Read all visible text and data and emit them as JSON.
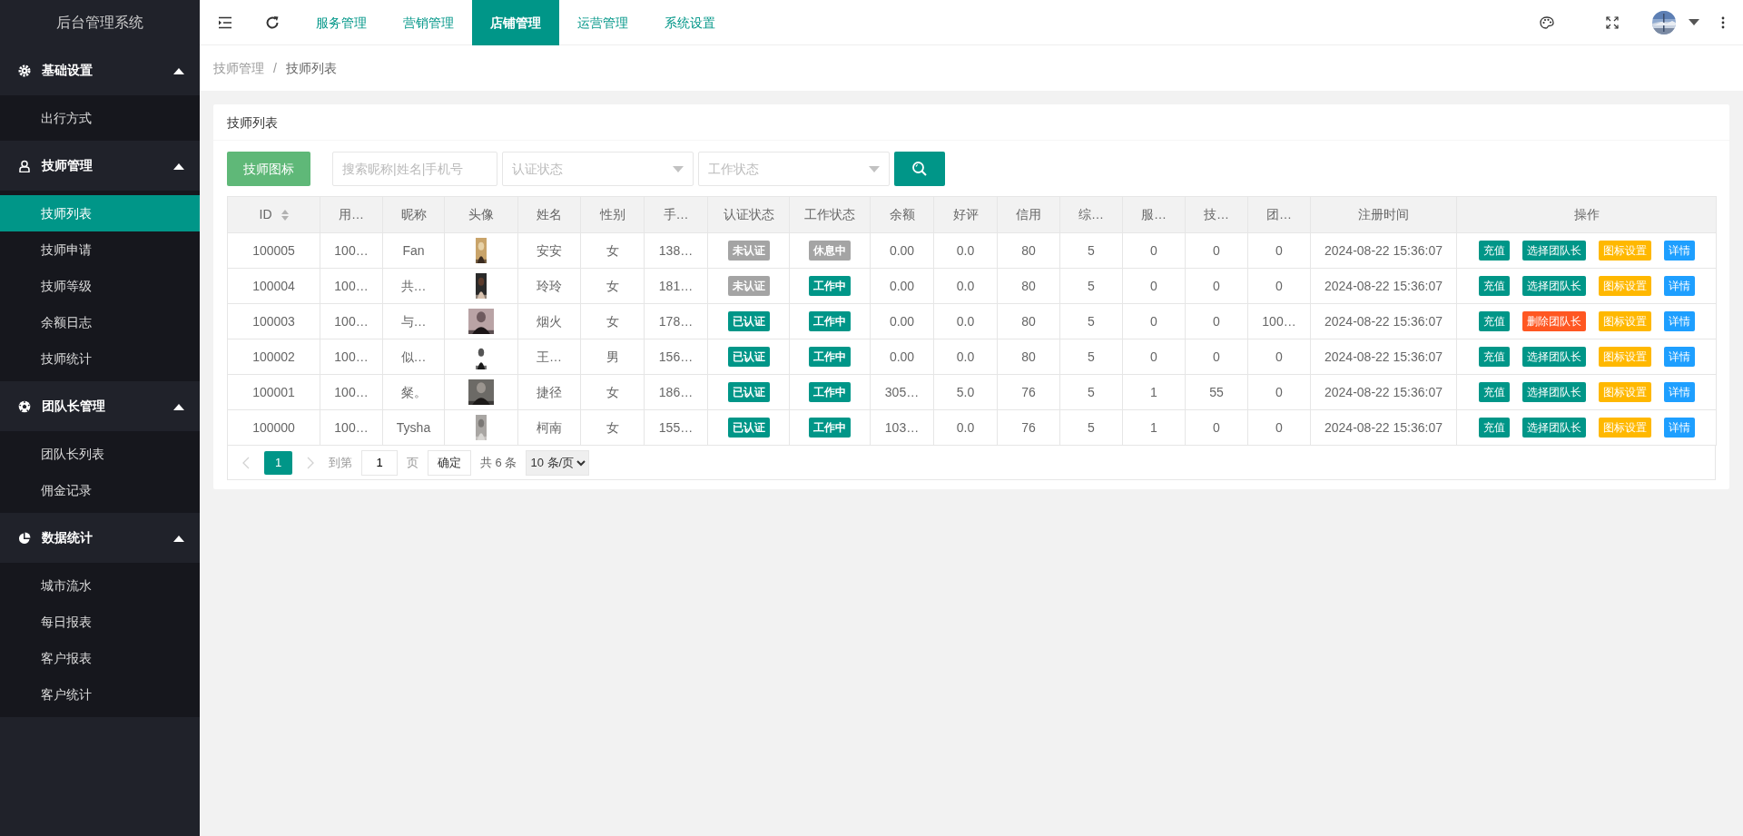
{
  "app_title": "后台管理系统",
  "sidebar": {
    "groups": [
      {
        "label": "基础设置",
        "expanded": true,
        "items": [
          {
            "label": "出行方式",
            "selected": false
          }
        ]
      },
      {
        "label": "技师管理",
        "expanded": true,
        "items": [
          {
            "label": "技师列表",
            "selected": true
          },
          {
            "label": "技师申请",
            "selected": false
          },
          {
            "label": "技师等级",
            "selected": false
          },
          {
            "label": "余额日志",
            "selected": false
          },
          {
            "label": "技师统计",
            "selected": false
          }
        ]
      },
      {
        "label": "团队长管理",
        "expanded": true,
        "items": [
          {
            "label": "团队长列表",
            "selected": false
          },
          {
            "label": "佣金记录",
            "selected": false
          }
        ]
      },
      {
        "label": "数据统计",
        "expanded": true,
        "items": [
          {
            "label": "城市流水",
            "selected": false
          },
          {
            "label": "每日报表",
            "selected": false
          },
          {
            "label": "客户报表",
            "selected": false
          },
          {
            "label": "客户统计",
            "selected": false
          }
        ]
      }
    ]
  },
  "topbar": {
    "tabs": [
      {
        "label": "服务管理",
        "selected": false
      },
      {
        "label": "营销管理",
        "selected": false
      },
      {
        "label": "店铺管理",
        "selected": true
      },
      {
        "label": "运营管理",
        "selected": false
      },
      {
        "label": "系统设置",
        "selected": false
      }
    ],
    "user_avatar": {
      "kind": "picture"
    }
  },
  "breadcrumb": [
    "技师管理",
    "技师列表"
  ],
  "breadcrumb_separator": "/",
  "card": {
    "title": "技师列表"
  },
  "toolbar": {
    "icon_button": "技师图标",
    "search": {
      "placeholder": "搜索昵称|姓名|手机号"
    },
    "filters": [
      {
        "placeholder": "认证状态"
      },
      {
        "placeholder": "工作状态"
      }
    ]
  },
  "table": {
    "columns": [
      {
        "label": "ID",
        "sortable": true
      },
      {
        "label": "用…",
        "sortable": false
      },
      {
        "label": "昵称",
        "sortable": false
      },
      {
        "label": "头像",
        "sortable": false
      },
      {
        "label": "姓名",
        "sortable": false
      },
      {
        "label": "性别",
        "sortable": false
      },
      {
        "label": "手…",
        "sortable": false
      },
      {
        "label": "认证状态",
        "sortable": false
      },
      {
        "label": "工作状态",
        "sortable": false
      },
      {
        "label": "余额",
        "sortable": false
      },
      {
        "label": "好评",
        "sortable": false
      },
      {
        "label": "信用",
        "sortable": false
      },
      {
        "label": "综…",
        "sortable": false
      },
      {
        "label": "服…",
        "sortable": false
      },
      {
        "label": "技…",
        "sortable": false
      },
      {
        "label": "团…",
        "sortable": false
      },
      {
        "label": "注册时间",
        "sortable": false
      },
      {
        "label": "操作",
        "sortable": false
      }
    ],
    "rows": [
      {
        "id": "100005",
        "user": "100…",
        "nickname": "Fan",
        "avatar": {
          "kind": "picture"
        },
        "name": "安安",
        "gender": "女",
        "phone": "138…",
        "auth": {
          "label": "未认证",
          "verified": false
        },
        "work": {
          "label": "休息中",
          "working": false
        },
        "balance": "0.00",
        "rating": "0.0",
        "credit": "80",
        "column_13": "5",
        "column_14": "0",
        "column_15": "0",
        "column_16": "0",
        "registered": "2024-08-22 15:36:07",
        "actions": [
          {
            "label": "充值",
            "kind": "recharge"
          },
          {
            "label": "选择团队长",
            "kind": "select"
          },
          {
            "label": "图标设置",
            "kind": "icon"
          },
          {
            "label": "详情",
            "kind": "detail"
          }
        ]
      },
      {
        "id": "100004",
        "user": "100…",
        "nickname": "共…",
        "avatar": {
          "kind": "picture"
        },
        "name": "玲玲",
        "gender": "女",
        "phone": "181…",
        "auth": {
          "label": "未认证",
          "verified": false
        },
        "work": {
          "label": "工作中",
          "working": true
        },
        "balance": "0.00",
        "rating": "0.0",
        "credit": "80",
        "column_13": "5",
        "column_14": "0",
        "column_15": "0",
        "column_16": "0",
        "registered": "2024-08-22 15:36:07",
        "actions": [
          {
            "label": "充值",
            "kind": "recharge"
          },
          {
            "label": "选择团队长",
            "kind": "select"
          },
          {
            "label": "图标设置",
            "kind": "icon"
          },
          {
            "label": "详情",
            "kind": "detail"
          }
        ]
      },
      {
        "id": "100003",
        "user": "100…",
        "nickname": "与…",
        "avatar": {
          "kind": "picture"
        },
        "name": "烟火",
        "gender": "女",
        "phone": "178…",
        "auth": {
          "label": "已认证",
          "verified": true
        },
        "work": {
          "label": "工作中",
          "working": true
        },
        "balance": "0.00",
        "rating": "0.0",
        "credit": "80",
        "column_13": "5",
        "column_14": "0",
        "column_15": "0",
        "column_16": "100…",
        "registered": "2024-08-22 15:36:07",
        "actions": [
          {
            "label": "充值",
            "kind": "recharge"
          },
          {
            "label": "删除团队长",
            "kind": "remove"
          },
          {
            "label": "图标设置",
            "kind": "icon"
          },
          {
            "label": "详情",
            "kind": "detail"
          }
        ]
      },
      {
        "id": "100002",
        "user": "100…",
        "nickname": "似…",
        "avatar": {
          "kind": "picture"
        },
        "name": "王…",
        "gender": "男",
        "phone": "156…",
        "auth": {
          "label": "已认证",
          "verified": true
        },
        "work": {
          "label": "工作中",
          "working": true
        },
        "balance": "0.00",
        "rating": "0.0",
        "credit": "80",
        "column_13": "5",
        "column_14": "0",
        "column_15": "0",
        "column_16": "0",
        "registered": "2024-08-22 15:36:07",
        "actions": [
          {
            "label": "充值",
            "kind": "recharge"
          },
          {
            "label": "选择团队长",
            "kind": "select"
          },
          {
            "label": "图标设置",
            "kind": "icon"
          },
          {
            "label": "详情",
            "kind": "detail"
          }
        ]
      },
      {
        "id": "100001",
        "user": "100…",
        "nickname": "粲。",
        "avatar": {
          "kind": "picture"
        },
        "name": "捷径",
        "gender": "女",
        "phone": "186…",
        "auth": {
          "label": "已认证",
          "verified": true
        },
        "work": {
          "label": "工作中",
          "working": true
        },
        "balance": "305…",
        "rating": "5.0",
        "credit": "76",
        "column_13": "5",
        "column_14": "1",
        "column_15": "55",
        "column_16": "0",
        "registered": "2024-08-22 15:36:07",
        "actions": [
          {
            "label": "充值",
            "kind": "recharge"
          },
          {
            "label": "选择团队长",
            "kind": "select"
          },
          {
            "label": "图标设置",
            "kind": "icon"
          },
          {
            "label": "详情",
            "kind": "detail"
          }
        ]
      },
      {
        "id": "100000",
        "user": "100…",
        "nickname": "Tysha",
        "avatar": {
          "kind": "picture"
        },
        "name": "柯南",
        "gender": "女",
        "phone": "155…",
        "auth": {
          "label": "已认证",
          "verified": true
        },
        "work": {
          "label": "工作中",
          "working": true
        },
        "balance": "103…",
        "rating": "0.0",
        "credit": "76",
        "column_13": "5",
        "column_14": "1",
        "column_15": "0",
        "column_16": "0",
        "registered": "2024-08-22 15:36:07",
        "actions": [
          {
            "label": "充值",
            "kind": "recharge"
          },
          {
            "label": "选择团队长",
            "kind": "select"
          },
          {
            "label": "图标设置",
            "kind": "icon"
          },
          {
            "label": "详情",
            "kind": "detail"
          }
        ]
      }
    ]
  },
  "pagination": {
    "pages": [
      {
        "label": "1",
        "selected": true
      }
    ],
    "goto_label": "到第",
    "goto_value": "1",
    "page_unit": "页",
    "confirm": "确定",
    "total": "共 6 条",
    "page_size": "10 条/页"
  }
}
